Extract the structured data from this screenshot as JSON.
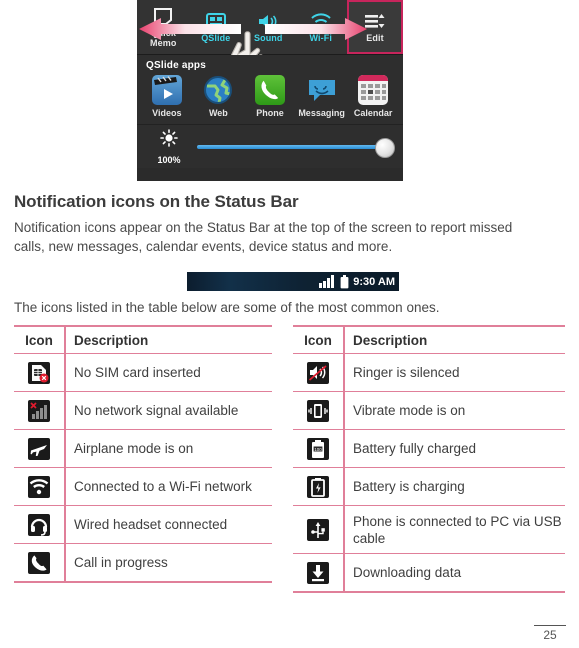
{
  "screenshot": {
    "quick_settings": [
      {
        "label": "Quick\nMemo",
        "label_line1": "Quick",
        "label_line2": "Memo",
        "icon": "quickmemo-icon",
        "color": "#e9e9e9"
      },
      {
        "label": "QSlide",
        "icon": "qslide-icon",
        "color": "#3fd4e8"
      },
      {
        "label": "Sound",
        "icon": "sound-icon",
        "color": "#3fd4e8"
      },
      {
        "label": "Wi-Fi",
        "icon": "wifi-icon",
        "color": "#3fd4e8"
      },
      {
        "label": "Edit",
        "icon": "edit-list-icon",
        "color": "#ffffff"
      }
    ],
    "qslide_section_title": "QSlide apps",
    "qslide_apps": [
      {
        "label": "Videos",
        "icon": "videos-icon"
      },
      {
        "label": "Web",
        "icon": "web-browser-icon"
      },
      {
        "label": "Phone",
        "icon": "phone-icon"
      },
      {
        "label": "Messaging",
        "icon": "messaging-icon"
      },
      {
        "label": "Calendar",
        "icon": "calendar-icon"
      }
    ],
    "brightness": {
      "icon": "brightness-sun-icon",
      "value_label": "100%",
      "slider_percent": 100
    },
    "overlay": {
      "left_arrow": "arrow-left",
      "right_arrow": "arrow-right",
      "hand": "hand-swipe-cursor"
    },
    "edit_highlight_color": "#c7255c"
  },
  "section": {
    "heading": "Notification icons on the Status Bar",
    "intro": "Notification icons appear on the Status Bar at the top of the screen to report missed calls, new messages, calendar events, device status and more.",
    "after_statusbar": "The icons listed in the table below are some of the most common ones."
  },
  "status_bar_image": {
    "signal_icon": "signal-bars-icon",
    "battery_icon": "battery-full-icon",
    "time": "9:30 AM"
  },
  "tables": {
    "headers": {
      "icon": "Icon",
      "description": "Description"
    },
    "left_rows": [
      {
        "icon": "no-sim-card-icon",
        "description": "No SIM card inserted"
      },
      {
        "icon": "no-network-signal-icon",
        "description": "No network signal available"
      },
      {
        "icon": "airplane-mode-icon",
        "description": "Airplane mode is on"
      },
      {
        "icon": "wifi-connected-icon",
        "description": "Connected to a Wi-Fi network"
      },
      {
        "icon": "wired-headset-icon",
        "description": "Wired headset connected"
      },
      {
        "icon": "call-in-progress-icon",
        "description": "Call in progress"
      }
    ],
    "right_rows": [
      {
        "icon": "ringer-silenced-icon",
        "description": "Ringer is silenced"
      },
      {
        "icon": "vibrate-mode-icon",
        "description": "Vibrate mode is on"
      },
      {
        "icon": "battery-full-icon",
        "description": "Battery fully charged"
      },
      {
        "icon": "battery-charging-icon",
        "description": "Battery is charging"
      },
      {
        "icon": "usb-connected-icon",
        "description": "Phone is connected to PC via USB cable"
      },
      {
        "icon": "downloading-data-icon",
        "description": "Downloading data"
      }
    ]
  },
  "footer": {
    "page_number": "25"
  },
  "colors": {
    "table_rule": "#e07f99",
    "accent_pink": "#c7255c",
    "cyan_label": "#3fd4e8",
    "slider_blue": "#2a8fd6"
  }
}
